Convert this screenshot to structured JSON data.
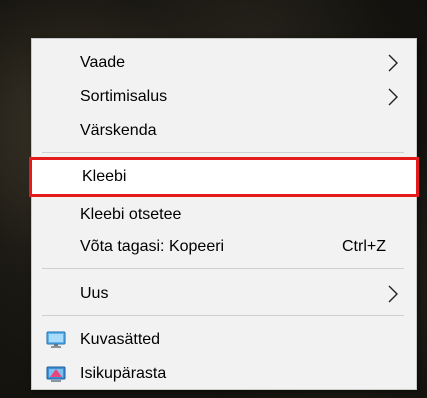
{
  "context_menu": {
    "items": [
      {
        "label": "Vaade",
        "icon": "chevron-right-icon"
      },
      {
        "label": "Sortimisalus",
        "icon": "chevron-right-icon"
      },
      {
        "label": "Värskenda"
      },
      {
        "label": "Kleebi",
        "highlighted": true
      },
      {
        "label": "Kleebi otsetee"
      },
      {
        "label": "Võta tagasi: Kopeeri",
        "shortcut": "Ctrl+Z"
      },
      {
        "label": "Uus",
        "icon": "chevron-right-icon"
      },
      {
        "label": "Kuvasätted",
        "icon": "display-settings-icon"
      },
      {
        "label": "Isikupärasta",
        "icon": "personalize-icon"
      }
    ]
  },
  "colors": {
    "menu_background": "#f2f2f2",
    "highlight_border": "#e31b1b",
    "separator": "#cfcfcf"
  }
}
